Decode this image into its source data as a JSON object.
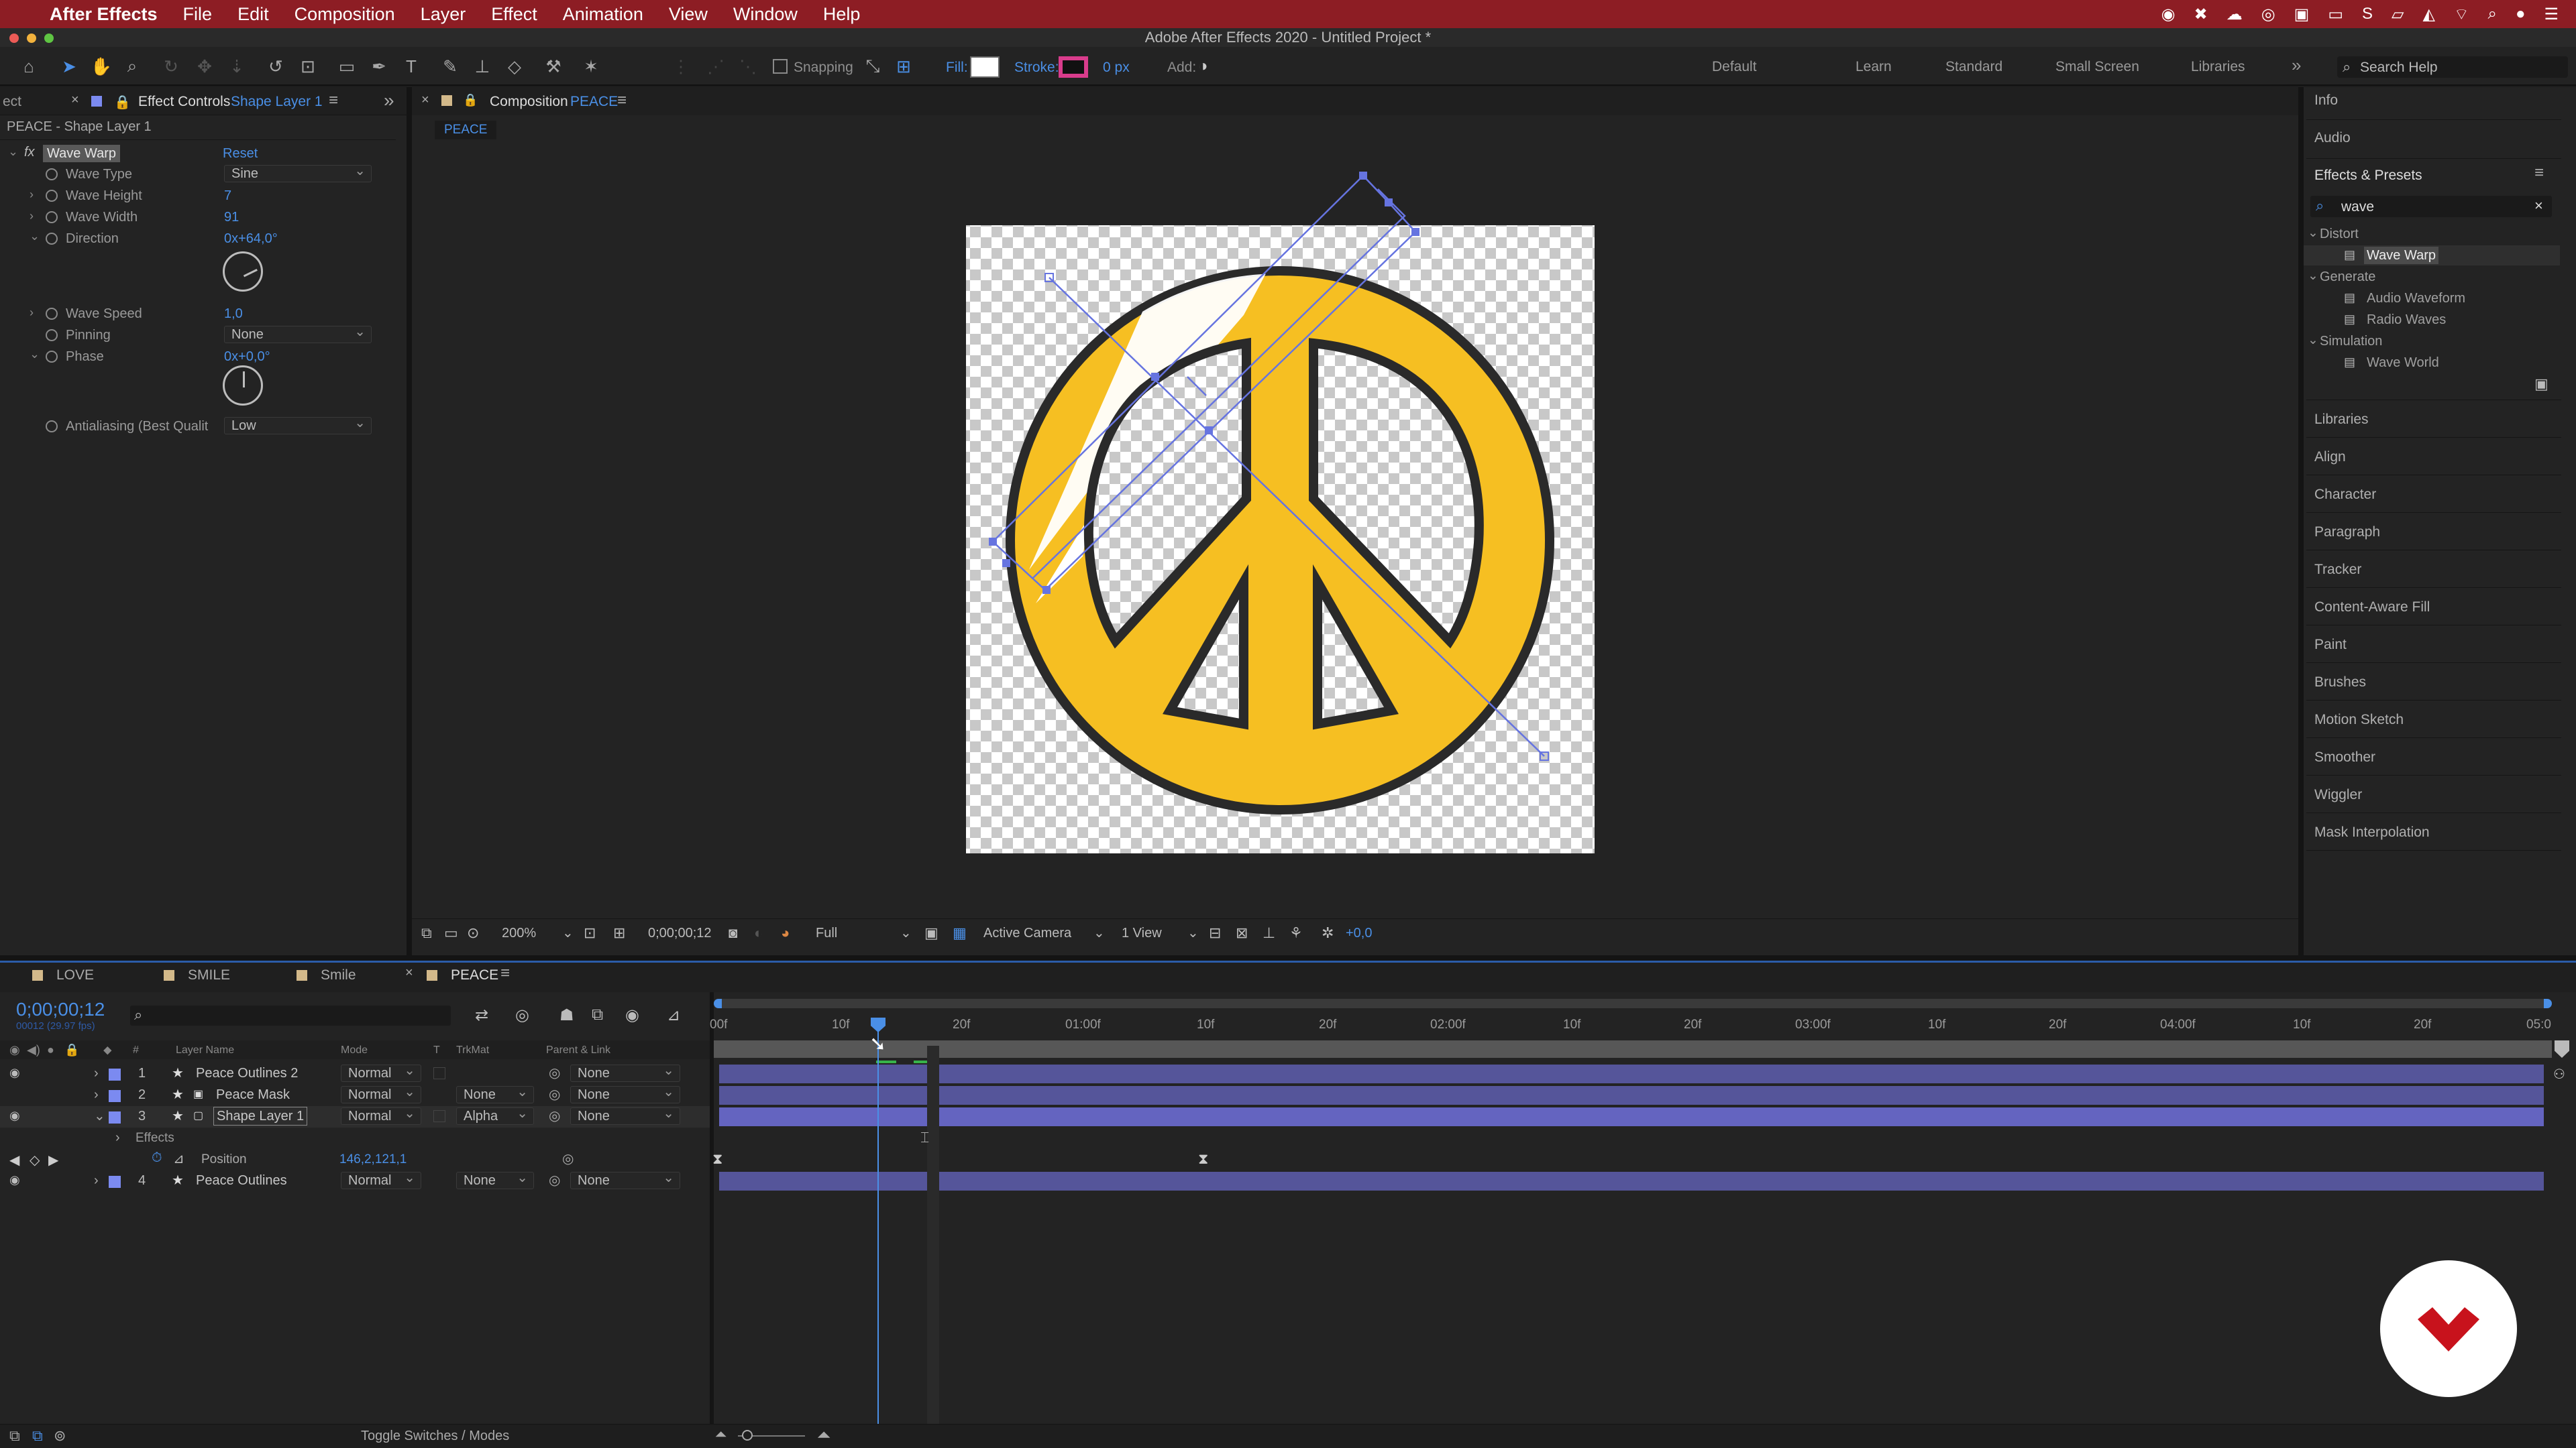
{
  "menubar": {
    "apple": "",
    "app_name": "After Effects",
    "items": [
      "File",
      "Edit",
      "Composition",
      "Layer",
      "Effect",
      "Animation",
      "View",
      "Window",
      "Help"
    ]
  },
  "window_title": "Adobe After Effects 2020 - Untitled Project *",
  "toolbar": {
    "snapping_label": "Snapping",
    "fill_label": "Fill:",
    "stroke_label": "Stroke:",
    "stroke_width": "0 px",
    "add_label": "Add:",
    "workspaces": [
      "Default",
      "Learn",
      "Standard",
      "Small Screen",
      "Libraries"
    ],
    "search_placeholder": "Search Help",
    "fill_color": "#ffffff",
    "stroke_color": "#d93c8c"
  },
  "effect_controls": {
    "tab_partial": "ect",
    "tab_label": "Effect Controls",
    "tab_layer": "Shape Layer 1",
    "header": "PEACE - Shape Layer 1",
    "effect_name": "Wave Warp",
    "reset": "Reset",
    "props": {
      "wave_type": {
        "label": "Wave Type",
        "value": "Sine"
      },
      "wave_height": {
        "label": "Wave Height",
        "value": "7"
      },
      "wave_width": {
        "label": "Wave Width",
        "value": "91"
      },
      "direction": {
        "label": "Direction",
        "value": "0x+64,0°"
      },
      "wave_speed": {
        "label": "Wave Speed",
        "value": "1,0"
      },
      "pinning": {
        "label": "Pinning",
        "value": "None"
      },
      "phase": {
        "label": "Phase",
        "value": "0x+0,0°"
      },
      "antialiasing": {
        "label": "Antialiasing (Best Qualit",
        "value": "Low"
      }
    }
  },
  "composition": {
    "tab_label": "Composition",
    "tab_name": "PEACE",
    "breadcrumb": "PEACE",
    "footer": {
      "zoom": "200%",
      "timecode": "0;00;00;12",
      "resolution": "Full",
      "camera": "Active Camera",
      "views": "1 View",
      "exposure": "+0,0"
    }
  },
  "right_panel": {
    "info": "Info",
    "audio": "Audio",
    "effects_presets": "Effects & Presets",
    "search_value": "wave",
    "groups": [
      {
        "name": "Distort",
        "items": [
          "Wave Warp"
        ]
      },
      {
        "name": "Generate",
        "items": [
          "Audio Waveform",
          "Radio Waves"
        ]
      },
      {
        "name": "Simulation",
        "items": [
          "Wave World"
        ]
      }
    ],
    "panels": [
      "Libraries",
      "Align",
      "Character",
      "Paragraph",
      "Tracker",
      "Content-Aware Fill",
      "Paint",
      "Brushes",
      "Motion Sketch",
      "Smoother",
      "Wiggler",
      "Mask Interpolation"
    ]
  },
  "timeline": {
    "tabs": [
      "LOVE",
      "SMILE",
      "Smile",
      "PEACE"
    ],
    "timecode": "0;00;00;12",
    "fps": "00012 (29.97 fps)",
    "columns": {
      "layer_name": "Layer Name",
      "mode": "Mode",
      "t": "T",
      "trkmat": "TrkMat",
      "parent": "Parent & Link"
    },
    "layers": [
      {
        "num": "1",
        "name": "Peace Outlines 2",
        "mode": "Normal",
        "trkmat": "",
        "parent": "None"
      },
      {
        "num": "2",
        "name": "Peace Mask",
        "mode": "Normal",
        "trkmat": "None",
        "parent": "None"
      },
      {
        "num": "3",
        "name": "Shape Layer 1",
        "mode": "Normal",
        "trkmat": "Alpha",
        "parent": "None"
      },
      {
        "num": "4",
        "name": "Peace Outlines",
        "mode": "Normal",
        "trkmat": "None",
        "parent": "None"
      }
    ],
    "effects_label": "Effects",
    "position_label": "Position",
    "position_value": "146,2,121,1",
    "ruler": [
      "00f",
      "10f",
      "20f",
      "01:00f",
      "10f",
      "20f",
      "02:00f",
      "10f",
      "20f",
      "03:00f",
      "10f",
      "20f",
      "04:00f",
      "10f",
      "20f",
      "05:0"
    ],
    "toggle_label": "Toggle Switches / Modes"
  }
}
